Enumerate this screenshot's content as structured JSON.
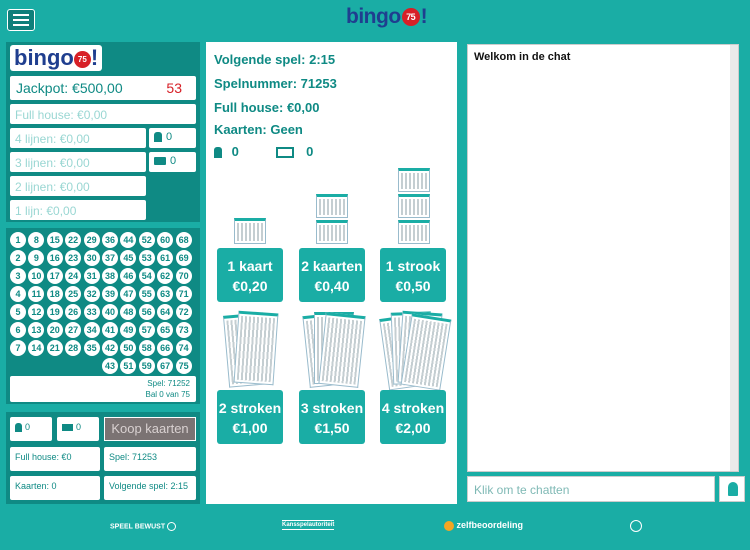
{
  "header": {
    "logo_text": "bingo",
    "logo_ball": "75",
    "logo_suffix": "!"
  },
  "left": {
    "logo_text": "bingo",
    "logo_ball": "75",
    "logo_suffix": "!",
    "jackpot_label": "Jackpot: €500,00",
    "jackpot_number": "53",
    "prizes": [
      "Full house: €0,00",
      "4 lijnen: €0,00",
      "3 lijnen: €0,00",
      "2 lijnen: €0,00",
      "1 lijn: €0,00"
    ],
    "players_count": "0",
    "cards_count": "0"
  },
  "numbers": {
    "rows": [
      [
        "1",
        "8",
        "15",
        "22",
        "29",
        "36",
        "44",
        "52",
        "60",
        "68"
      ],
      [
        "2",
        "9",
        "16",
        "23",
        "30",
        "37",
        "45",
        "53",
        "61",
        "69"
      ],
      [
        "3",
        "10",
        "17",
        "24",
        "31",
        "38",
        "46",
        "54",
        "62",
        "70"
      ],
      [
        "4",
        "11",
        "18",
        "25",
        "32",
        "39",
        "47",
        "55",
        "63",
        "71"
      ],
      [
        "5",
        "12",
        "19",
        "26",
        "33",
        "40",
        "48",
        "56",
        "64",
        "72"
      ],
      [
        "6",
        "13",
        "20",
        "27",
        "34",
        "41",
        "49",
        "57",
        "65",
        "73"
      ],
      [
        "7",
        "14",
        "21",
        "28",
        "35",
        "42",
        "50",
        "58",
        "66",
        "74"
      ],
      [
        "",
        "",
        "",
        "",
        "",
        "",
        "43",
        "51",
        "59",
        "67",
        "75"
      ]
    ],
    "game_label": "Spel: 71252",
    "ball_label": "Bal 0 van 75"
  },
  "buy": {
    "players_count": "0",
    "cards_count": "0",
    "buy_label": "Koop kaarten",
    "full_house": "Full house: €0",
    "game": "Spel: 71253",
    "cards": "Kaarten: 0",
    "next_game": "Volgende spel: 2:15"
  },
  "middle": {
    "next_game": "Volgende spel: 2:15",
    "game_number": "Spelnummer: 71253",
    "full_house": "Full house: €0,00",
    "cards": "Kaarten: Geen",
    "players_count": "0",
    "cards_count": "0",
    "options": [
      {
        "name": "1 kaart",
        "price": "€0,20"
      },
      {
        "name": "2 kaarten",
        "price": "€0,40"
      },
      {
        "name": "1 strook",
        "price": "€0,50"
      },
      {
        "name": "2 stroken",
        "price": "€1,00"
      },
      {
        "name": "3 stroken",
        "price": "€1,50"
      },
      {
        "name": "4 stroken",
        "price": "€2,00"
      }
    ]
  },
  "chat": {
    "welcome": "Welkom in de chat",
    "placeholder": "Klik om te chatten"
  },
  "footer": {
    "speel_bewust": "SPEEL BEWUST",
    "kansspel": "Kansspelautoriteit",
    "zelfbeoordeling": "zelfbeoordeling"
  },
  "colors": {
    "primary": "#1aada5",
    "dark": "#0f8a84",
    "accent_red": "#d72027",
    "logo_blue": "#1f3e8f"
  }
}
